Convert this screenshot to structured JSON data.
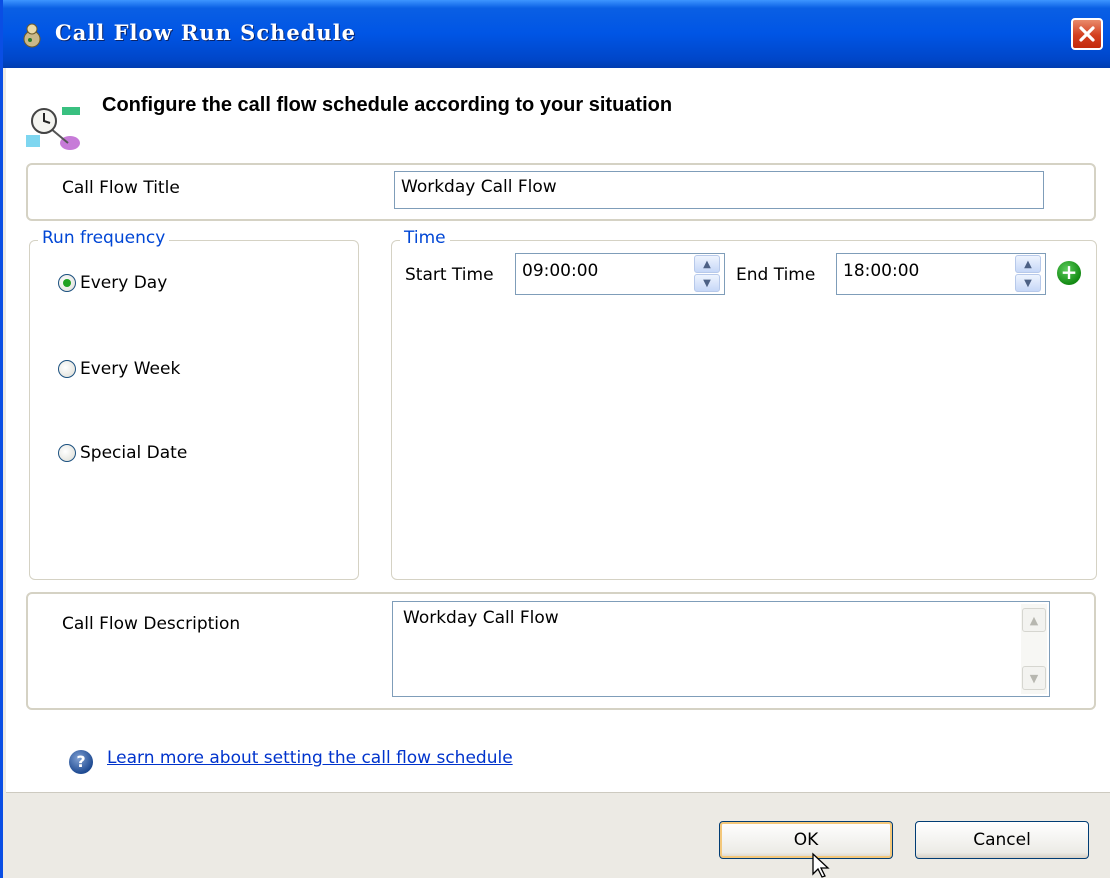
{
  "window": {
    "title": "Call Flow Run Schedule"
  },
  "header": {
    "text": "Configure the call flow schedule according to your situation"
  },
  "title_section": {
    "label": "Call Flow Title",
    "value": "Workday Call Flow"
  },
  "run_frequency": {
    "legend": "Run frequency",
    "options": [
      {
        "label": "Every Day",
        "checked": true
      },
      {
        "label": "Every Week",
        "checked": false
      },
      {
        "label": "Special Date",
        "checked": false
      }
    ]
  },
  "time": {
    "legend": "Time",
    "start_label": "Start Time",
    "start_value": "09:00:00",
    "end_label": "End Time",
    "end_value": "18:00:00"
  },
  "description": {
    "label": "Call Flow Description",
    "value": "Workday Call Flow"
  },
  "help": {
    "link_text": "Learn more about setting the call flow schedule"
  },
  "buttons": {
    "ok": "OK",
    "cancel": "Cancel"
  },
  "colors": {
    "titlebar": "#0055e5",
    "legend": "#0046d5",
    "link": "#0033cc",
    "radio_checked": "#21a121",
    "add_button": "#138a13"
  },
  "icons": [
    "app-icon",
    "close-icon",
    "schedule-clock-icon",
    "spin-up-icon",
    "spin-down-icon",
    "add-time-icon",
    "help-icon",
    "mouse-cursor-icon"
  ]
}
